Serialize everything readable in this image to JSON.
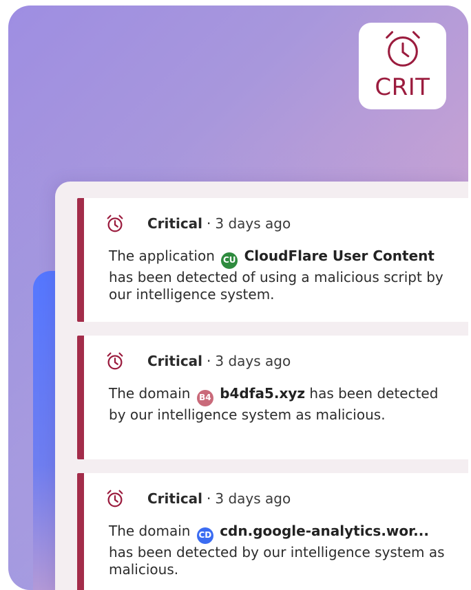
{
  "badge": {
    "label": "CRIT",
    "icon": "alarm-clock-icon",
    "color": "#9b1c3e"
  },
  "alerts": [
    {
      "severity": "Critical",
      "separator": "·",
      "time": "3 days ago",
      "text_before": "The application",
      "chip": {
        "initials": "CU",
        "color": "#2e8b3e"
      },
      "entity": "CloudFlare User Content",
      "text_after": "has been detected of using a malicious script by our intelligence system."
    },
    {
      "severity": "Critical",
      "separator": "·",
      "time": "3 days ago",
      "text_before": "The domain",
      "chip": {
        "initials": "B4",
        "color": "#c96a7a"
      },
      "entity": "b4dfa5.xyz",
      "text_after": "has been detected by our intelligence system as malicious."
    },
    {
      "severity": "Critical",
      "separator": "·",
      "time": "3 days ago",
      "text_before": "The domain",
      "chip": {
        "initials": "CD",
        "color": "#3b6cf2"
      },
      "entity": "cdn.google-analytics.wor...",
      "text_after": "has been detected by our intelligence system as malicious."
    }
  ],
  "colors": {
    "accent": "#a32c4a",
    "alarm_icon": "#9b1c3e"
  }
}
